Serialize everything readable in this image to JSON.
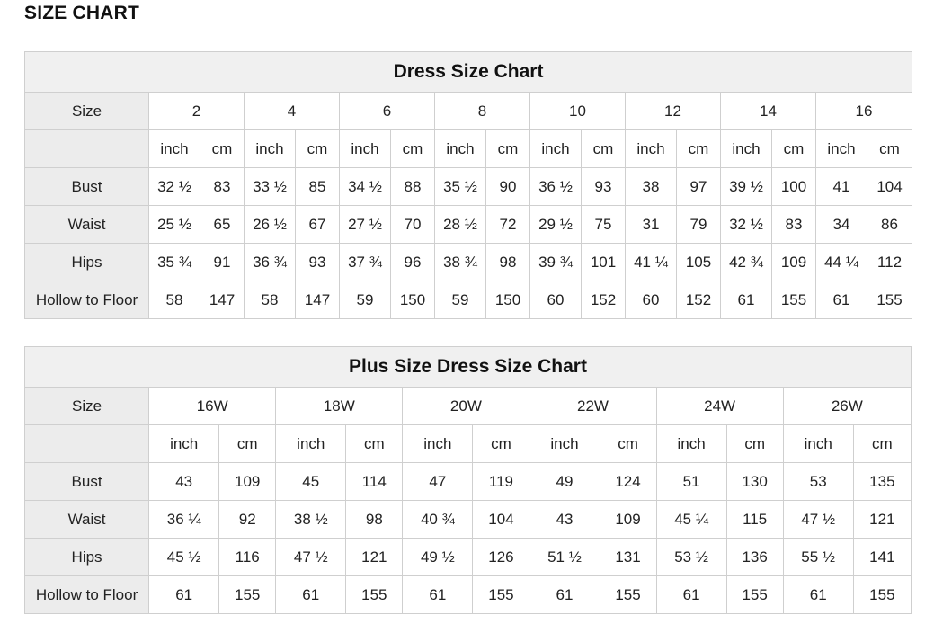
{
  "page_title": "SIZE CHART",
  "dress_chart": {
    "title": "Dress Size Chart",
    "size_label": "Size",
    "sizes": [
      "2",
      "4",
      "6",
      "8",
      "10",
      "12",
      "14",
      "16"
    ],
    "unit_inch": "inch",
    "unit_cm": "cm",
    "rows": [
      {
        "label": "Bust",
        "values": [
          "32 ½",
          "83",
          "33 ½",
          "85",
          "34 ½",
          "88",
          "35 ½",
          "90",
          "36 ½",
          "93",
          "38",
          "97",
          "39 ½",
          "100",
          "41",
          "104"
        ]
      },
      {
        "label": "Waist",
        "values": [
          "25 ½",
          "65",
          "26 ½",
          "67",
          "27 ½",
          "70",
          "28 ½",
          "72",
          "29 ½",
          "75",
          "31",
          "79",
          "32 ½",
          "83",
          "34",
          "86"
        ]
      },
      {
        "label": "Hips",
        "values": [
          "35 ¾",
          "91",
          "36 ¾",
          "93",
          "37 ¾",
          "96",
          "38 ¾",
          "98",
          "39 ¾",
          "101",
          "41 ¼",
          "105",
          "42 ¾",
          "109",
          "44 ¼",
          "112"
        ]
      },
      {
        "label": "Hollow to Floor",
        "values": [
          "58",
          "147",
          "58",
          "147",
          "59",
          "150",
          "59",
          "150",
          "60",
          "152",
          "60",
          "152",
          "61",
          "155",
          "61",
          "155"
        ]
      }
    ]
  },
  "plus_chart": {
    "title": "Plus Size Dress Size Chart",
    "size_label": "Size",
    "sizes": [
      "16W",
      "18W",
      "20W",
      "22W",
      "24W",
      "26W"
    ],
    "unit_inch": "inch",
    "unit_cm": "cm",
    "rows": [
      {
        "label": "Bust",
        "values": [
          "43",
          "109",
          "45",
          "114",
          "47",
          "119",
          "49",
          "124",
          "51",
          "130",
          "53",
          "135"
        ]
      },
      {
        "label": "Waist",
        "values": [
          "36 ¼",
          "92",
          "38 ½",
          "98",
          "40 ¾",
          "104",
          "43",
          "109",
          "45 ¼",
          "115",
          "47 ½",
          "121"
        ]
      },
      {
        "label": "Hips",
        "values": [
          "45 ½",
          "116",
          "47 ½",
          "121",
          "49 ½",
          "126",
          "51 ½",
          "131",
          "53 ½",
          "136",
          "55 ½",
          "141"
        ]
      },
      {
        "label": "Hollow to Floor",
        "values": [
          "61",
          "155",
          "61",
          "155",
          "61",
          "155",
          "61",
          "155",
          "61",
          "155",
          "61",
          "155"
        ]
      }
    ]
  }
}
